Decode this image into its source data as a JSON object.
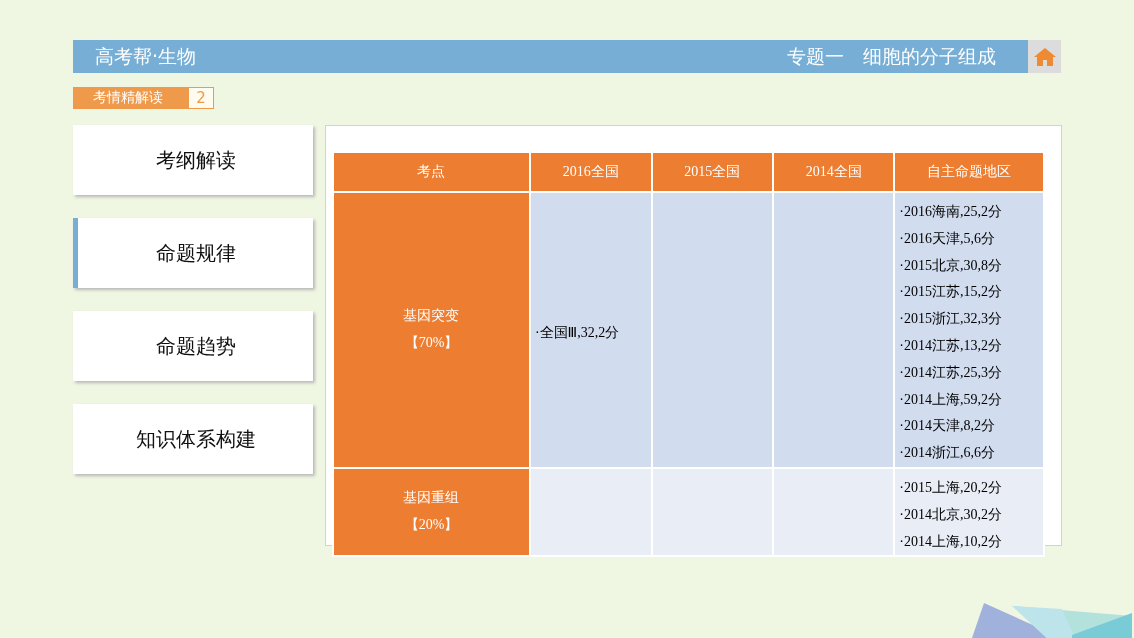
{
  "header": {
    "title": "高考帮·生物",
    "subtitle": "专题一　细胞的分子组成"
  },
  "tag": {
    "label": "考情精解读",
    "number": "2"
  },
  "sidebar": {
    "items": [
      {
        "label": "考纲解读",
        "selected": false
      },
      {
        "label": "命题规律",
        "selected": true
      },
      {
        "label": "命题趋势",
        "selected": false
      },
      {
        "label": "知识体系构建",
        "selected": false
      }
    ]
  },
  "table": {
    "columns": [
      "考点",
      "2016全国",
      "2015全国",
      "2014全国",
      "自主命题地区"
    ],
    "rows": [
      {
        "topic": "基因突变",
        "share": "【70%】",
        "national_2016": [
          "·全国Ⅲ,32,2分"
        ],
        "national_2015": [],
        "national_2014": [],
        "regions": [
          "·2016海南,25,2分",
          "·2016天津,5,6分",
          "·2015北京,30,8分",
          "·2015江苏,15,2分",
          "·2015浙江,32,3分",
          "·2014江苏,13,2分",
          "·2014江苏,25,3分",
          "·2014上海,59,2分",
          "·2014天津,8,2分",
          "·2014浙江,6,6分"
        ]
      },
      {
        "topic": "基因重组",
        "share": "【20%】",
        "national_2016": [],
        "national_2015": [],
        "national_2014": [],
        "regions": [
          "·2015上海,20,2分",
          "·2014北京,30,2分",
          "·2014上海,10,2分"
        ]
      }
    ]
  }
}
